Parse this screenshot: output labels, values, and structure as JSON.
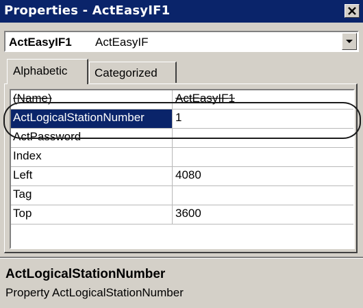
{
  "window": {
    "title": "Properties - ActEasyIF1",
    "close_icon": "close-icon"
  },
  "object_selector": {
    "name": "ActEasyIF1",
    "type": "ActEasyIF",
    "arrow_icon": "chevron-down-icon"
  },
  "tabs": [
    {
      "label": "Alphabetic",
      "selected": true
    },
    {
      "label": "Categorized",
      "selected": false
    }
  ],
  "properties": [
    {
      "name": "(Name)",
      "value": "ActEasyIF1"
    },
    {
      "name": "ActLogicalStationNumber",
      "value": "1",
      "selected": true
    },
    {
      "name": "ActPassword",
      "value": ""
    },
    {
      "name": "Index",
      "value": ""
    },
    {
      "name": "Left",
      "value": "4080"
    },
    {
      "name": "Tag",
      "value": ""
    },
    {
      "name": "Top",
      "value": "3600"
    }
  ],
  "description": {
    "title": "ActLogicalStationNumber",
    "text": "Property ActLogicalStationNumber"
  },
  "colors": {
    "title_bar": "#0a246a",
    "selection": "#0a246a",
    "face": "#d4d0c8"
  }
}
